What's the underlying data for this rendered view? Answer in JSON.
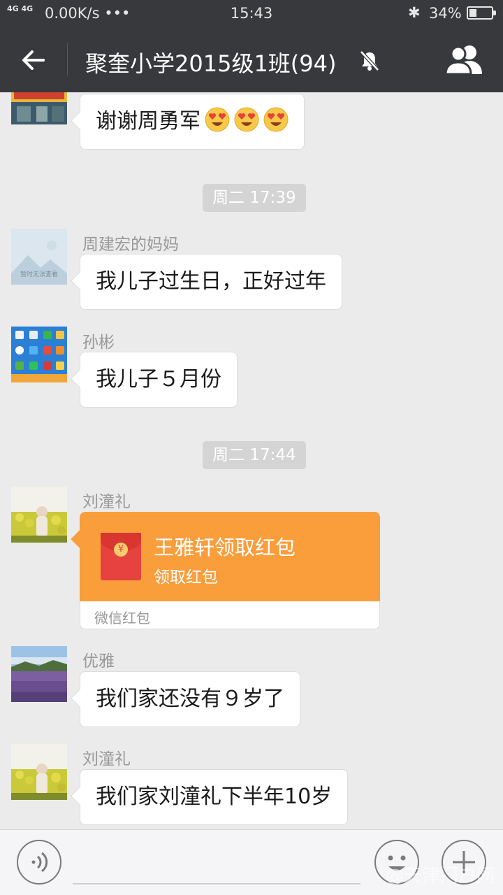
{
  "status_bar": {
    "network": "4G 4G",
    "speed": "0.00K/s",
    "dots": "•••",
    "time": "15:43",
    "bluetooth": "✱",
    "battery": "34%",
    "battery_level": 0.34
  },
  "header": {
    "title": "聚奎小学2015级1班(94)",
    "back_icon": "back-arrow-icon",
    "mute_icon": "muted-bell-icon",
    "members_icon": "group-members-icon",
    "bar_color": "#37393c"
  },
  "messages": [
    {
      "type": "text",
      "text": "谢谢周勇军",
      "emoji_count": 3,
      "emoji": "heart-eyes-emoji"
    },
    {
      "type": "timestamp",
      "text": "周二 17:39"
    },
    {
      "type": "text",
      "sender": "周建宏的妈妈",
      "text": "我儿子过生日，正好过年",
      "avatar_caption": "暂时无法查看"
    },
    {
      "type": "text",
      "sender": "孙彬",
      "text": "我儿子５月份"
    },
    {
      "type": "timestamp",
      "text": "周二 17:44"
    },
    {
      "type": "red_packet",
      "sender": "刘潼礼",
      "title": "王雅轩领取红包",
      "subtitle": "领取红包",
      "label": "微信红包",
      "coin": "¥",
      "color": "#fa9d3b"
    },
    {
      "type": "text",
      "sender": "优雅",
      "text": "我们家还没有９岁了"
    },
    {
      "type": "text",
      "sender": "刘潼礼",
      "text": "我们家刘潼礼下半年10岁"
    }
  ],
  "input_bar": {
    "voice_icon": "voice-icon",
    "emoji_icon": "smiley-icon",
    "more_icon": "plus-icon"
  },
  "watermark": "@天津门户网"
}
